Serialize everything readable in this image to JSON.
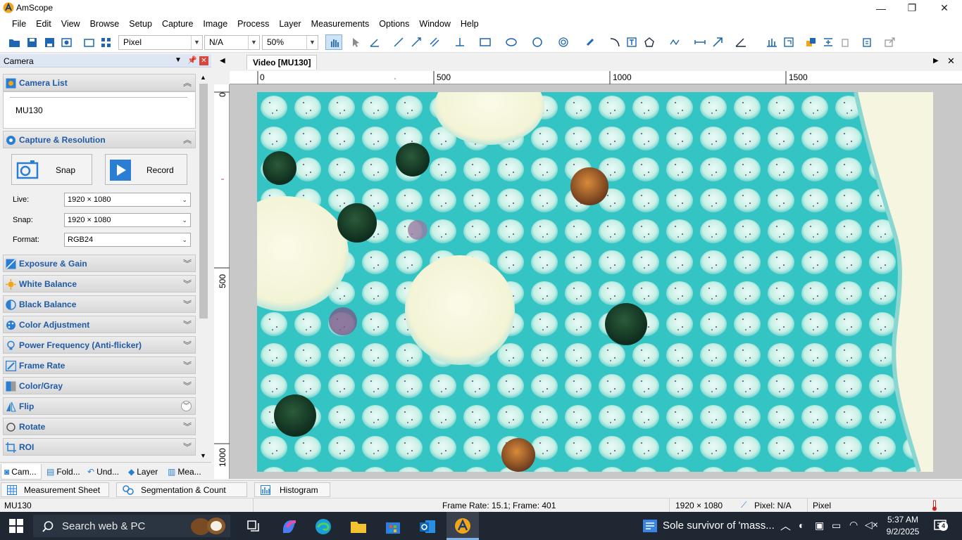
{
  "window": {
    "title": "AmScope",
    "minimize": "—",
    "maximize": "❐",
    "close": "✕"
  },
  "menu": [
    "File",
    "Edit",
    "View",
    "Browse",
    "Setup",
    "Capture",
    "Image",
    "Process",
    "Layer",
    "Measurements",
    "Options",
    "Window",
    "Help"
  ],
  "toolbar": {
    "unit": "Pixel",
    "magnification": "N/A",
    "zoom": "50%"
  },
  "left_panel": {
    "title": "Camera",
    "camera_list": {
      "label": "Camera List",
      "item": "MU130"
    },
    "capture": {
      "label": "Capture & Resolution",
      "snap_label": "Snap",
      "record_label": "Record",
      "live_label": "Live:",
      "live_value": "1920 × 1080",
      "snap_field_label": "Snap:",
      "snap_value": "1920 × 1080",
      "format_label": "Format:",
      "format_value": "RGB24"
    },
    "sections": [
      "Exposure & Gain",
      "White Balance",
      "Black Balance",
      "Color Adjustment",
      "Power Frequency (Anti-flicker)",
      "Frame Rate",
      "Color/Gray",
      "Flip",
      "Rotate",
      "ROI"
    ],
    "tabs": [
      "Cam...",
      "Fold...",
      "Und...",
      "Layer",
      "Mea..."
    ]
  },
  "document": {
    "tab_label": "Video [MU130]",
    "h_ruler_labels": [
      "0",
      "500",
      "1000",
      "1500"
    ],
    "v_ruler_labels": [
      "0",
      "500",
      "1000"
    ]
  },
  "bottom_tabs": [
    "Measurement Sheet",
    "Segmentation & Count",
    "Histogram"
  ],
  "status": {
    "camera": "MU130",
    "frame": "Frame Rate: 15.1; Frame: 401",
    "resolution": "1920 × 1080",
    "pixel": "Pixel: N/A",
    "unit": "Pixel"
  },
  "taskbar": {
    "search": "Search web & PC",
    "news": "Sole survivor of 'mass...",
    "time": "5:37 AM",
    "date": "9/2/2025",
    "notifications": "4"
  },
  "colors": {
    "accent": "#1f5aa6",
    "taskbar": "#1f2733",
    "panel_header": "#dde6f2",
    "stain": "#35c4c4"
  }
}
